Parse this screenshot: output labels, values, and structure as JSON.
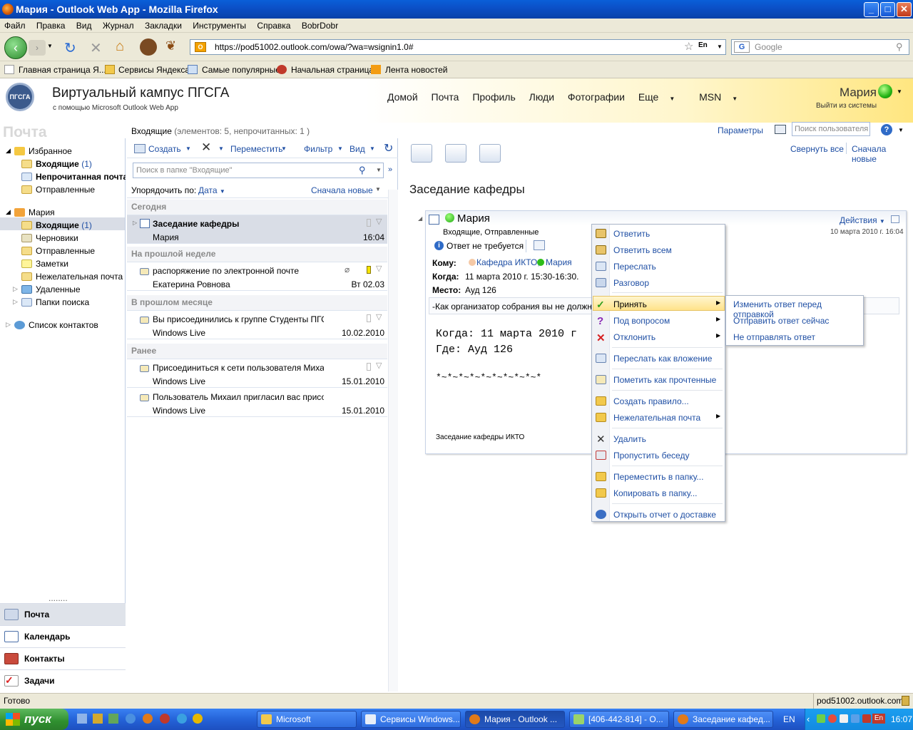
{
  "window": {
    "title": "Мария - Outlook Web App - Mozilla Firefox"
  },
  "menu": [
    "Файл",
    "Правка",
    "Вид",
    "Журнал",
    "Закладки",
    "Инструменты",
    "Справка",
    "BobrDobr"
  ],
  "url": "https://pod51002.outlook.com/owa/?wa=wsignin1.0#",
  "lang_badge": "En",
  "google_placeholder": "Google",
  "bookmarks": [
    "Главная страница Я...",
    "Сервисы Яндекса",
    "Самые популярные",
    "Начальная страница",
    "Лента новостей"
  ],
  "owa": {
    "logo_text": "ПГСГА",
    "site_title": "Виртуальный кампус ПГСГА",
    "site_sub": "с помощью Microsoft Outlook Web App",
    "nav": [
      "Домой",
      "Почта",
      "Профиль",
      "Люди",
      "Фотографии",
      "Еще",
      "MSN"
    ],
    "user": "Мария",
    "logout": "Выйти из системы",
    "params": "Параметры",
    "user_search_placeholder": "Поиск пользователя",
    "section_title": "Почта",
    "folder_title": "Входящие",
    "folder_counts": "(элементов: 5, непрочитанных: 1 )"
  },
  "leftnav": {
    "favorites": "Избранное",
    "fav_inbox": "Входящие",
    "fav_inbox_count": "(1)",
    "fav_unread": "Непрочитанная почта",
    "fav_sent": "Отправленные",
    "mailbox": "Мария",
    "inbox": "Входящие",
    "inbox_count": "(1)",
    "drafts": "Черновики",
    "sent": "Отправленные",
    "notes": "Заметки",
    "junk": "Нежелательная почта",
    "deleted": "Удаленные",
    "search_folders": "Папки поиска",
    "contacts_list": "Список контактов",
    "splitter": "........",
    "buttons": [
      "Почта",
      "Календарь",
      "Контакты",
      "Задачи"
    ]
  },
  "msglist": {
    "create": "Создать",
    "move": "Переместить",
    "filter": "Фильтр",
    "view": "Вид",
    "search_placeholder": "Поиск в папке \"Входящие\"",
    "sort_by": "Упорядочить по:",
    "sort_field": "Дата",
    "sort_order": "Сначала новые",
    "groups": [
      "Сегодня",
      "На прошлой неделе",
      "В прошлом месяце",
      "Ранее"
    ],
    "items": [
      {
        "subject": "Заседание кафедры",
        "from": "Мария",
        "date": "16:04"
      },
      {
        "subject": "распоряжение по электронной почте",
        "from": "Екатерина Ровнова",
        "date": "Вт 02.03"
      },
      {
        "subject": "Вы присоединились к группе Студенты ПГСГА",
        "from": "Windows Live",
        "date": "10.02.2010"
      },
      {
        "subject": "Присоединиться к сети пользователя Михаил к",
        "from": "Windows Live",
        "date": "15.01.2010"
      },
      {
        "subject": "Пользователь Михаил пригласил вас присоеди",
        "from": "Windows Live",
        "date": "15.01.2010"
      }
    ]
  },
  "reading": {
    "collapse_all": "Свернуть все",
    "newest_first": "Сначала новые",
    "subject": "Заседание кафедры",
    "sender": "Мария",
    "actions": "Действия",
    "folders": "Входящие, Отправленные",
    "date": "10 марта 2010 г. 16:04",
    "no_reply": "Ответ не требуется",
    "to_label": "Кому:",
    "to_1": "Кафедра ИКТО;",
    "to_2": "Мария",
    "when_label": "Когда:",
    "when": "11 марта 2010 г. 15:30-16:30.",
    "where_label": "Место:",
    "where": "Ауд 126",
    "organizer_note": "-Как организатор собрания вы не должны о",
    "body_when": "Когда: 11 марта 2010 г",
    "body_where": "Где: Ауд 126",
    "body_line": "*~*~*~*~*~*~*~*~*~*",
    "footer": "Заседание кафедры ИКТО"
  },
  "context_menu": [
    "Ответить",
    "Ответить всем",
    "Переслать",
    "Разговор",
    "Принять",
    "Под вопросом",
    "Отклонить",
    "Переслать как вложение",
    "Пометить как прочтенные",
    "Создать правило...",
    "Нежелательная почта",
    "Удалить",
    "Пропустить беседу",
    "Переместить в папку...",
    "Копировать в папку...",
    "Открыть отчет о доставке"
  ],
  "submenu": [
    "Изменить ответ перед отправкой",
    "Отправить ответ сейчас",
    "Не отправлять ответ"
  ],
  "status": {
    "left": "Готово",
    "right": "pod51002.outlook.com"
  },
  "taskbar": {
    "start": "пуск",
    "tasks": [
      "Microsoft",
      "Сервисы Windows...",
      "Мария - Outlook ...",
      "[406-442-814] - О...",
      "Заседание кафед..."
    ],
    "lang": "EN",
    "tray_lang": "En",
    "clock": "16:07"
  }
}
